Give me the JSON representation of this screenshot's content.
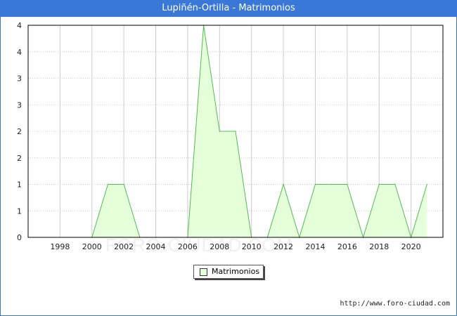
{
  "header": {
    "title": "Lupiñén-Ortilla - Matrimonios"
  },
  "footer": {
    "source": "http://www.foro-ciudad.com"
  },
  "watermark": "FORO-CIUDAD.COM",
  "legend": {
    "label": "Matrimonios"
  },
  "colors": {
    "fill": "#e4ffd9",
    "line": "#55bb55",
    "grid": "#cccccc",
    "accent": "#3a78d8"
  },
  "chart_data": {
    "type": "area",
    "title": "Lupiñén-Ortilla - Matrimonios",
    "xlabel": "",
    "ylabel": "",
    "xlim": [
      1996,
      2022
    ],
    "ylim": [
      0,
      4
    ],
    "grid": true,
    "legend_position": "bottom",
    "x_ticks": [
      1998,
      2000,
      2002,
      2004,
      2006,
      2008,
      2010,
      2012,
      2014,
      2016,
      2018,
      2020
    ],
    "y_tick_labels": [
      "0",
      "1",
      "1",
      "2",
      "2",
      "3",
      "3",
      "4",
      "4"
    ],
    "series": [
      {
        "name": "Matrimonios",
        "x": [
          2000,
          2001,
          2002,
          2003,
          2004,
          2005,
          2006,
          2007,
          2008,
          2009,
          2010,
          2011,
          2012,
          2013,
          2014,
          2015,
          2016,
          2017,
          2018,
          2019,
          2020,
          2021
        ],
        "y": [
          0,
          1,
          1,
          0,
          0,
          0,
          0,
          4,
          2,
          2,
          0,
          0,
          1,
          0,
          1,
          1,
          1,
          0,
          1,
          1,
          0,
          1
        ]
      }
    ]
  }
}
